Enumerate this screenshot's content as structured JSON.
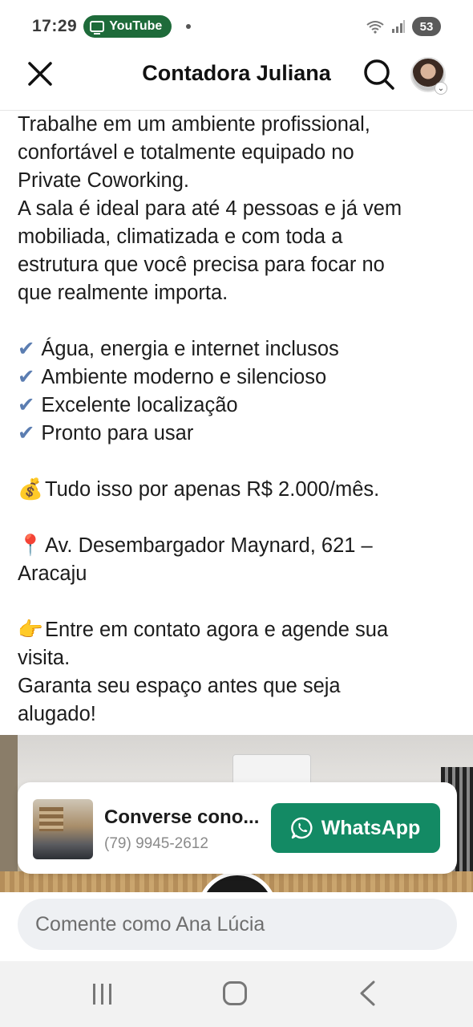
{
  "status_bar": {
    "time": "17:29",
    "app_pill": "YouTube",
    "battery": "53"
  },
  "header": {
    "title": "Contadora Juliana"
  },
  "post": {
    "intro_lines": [
      "Trabalhe em um ambiente profissional,",
      "confortável e totalmente equipado no",
      "Private Coworking.",
      "A sala é ideal para até 4 pessoas e já vem",
      "mobiliada, climatizada e com toda a",
      "estrutura que você precisa para focar no",
      "que realmente importa."
    ],
    "features": [
      "Água, energia e internet inclusos",
      "Ambiente moderno e silencioso",
      "Excelente localização",
      "Pronto para usar"
    ],
    "check_glyph": "✔",
    "price_emoji": "💰",
    "price": "Tudo isso por apenas R$ 2.000/mês.",
    "pin_emoji": "📍",
    "address_line1": "Av. Desembargador Maynard, 621 –",
    "address_line2": "Aracaju",
    "point_emoji": "👉",
    "cta_line1": "Entre em contato agora e agende sua",
    "cta_line2": "visita.",
    "cta_line3": "Garanta seu espaço antes que seja",
    "cta_line4": "alugado!"
  },
  "whatsapp_card": {
    "title": "Converse cono...",
    "phone": "(79) 9945-2612",
    "button_label": "WhatsApp",
    "button_color": "#138a64"
  },
  "comment": {
    "placeholder": "Comente como Ana Lúcia"
  },
  "icons": {
    "close": "close-icon",
    "search": "search-icon",
    "whatsapp": "whatsapp-icon",
    "nav_recent": "recent-apps-icon",
    "nav_home": "home-icon",
    "nav_back": "back-icon"
  }
}
